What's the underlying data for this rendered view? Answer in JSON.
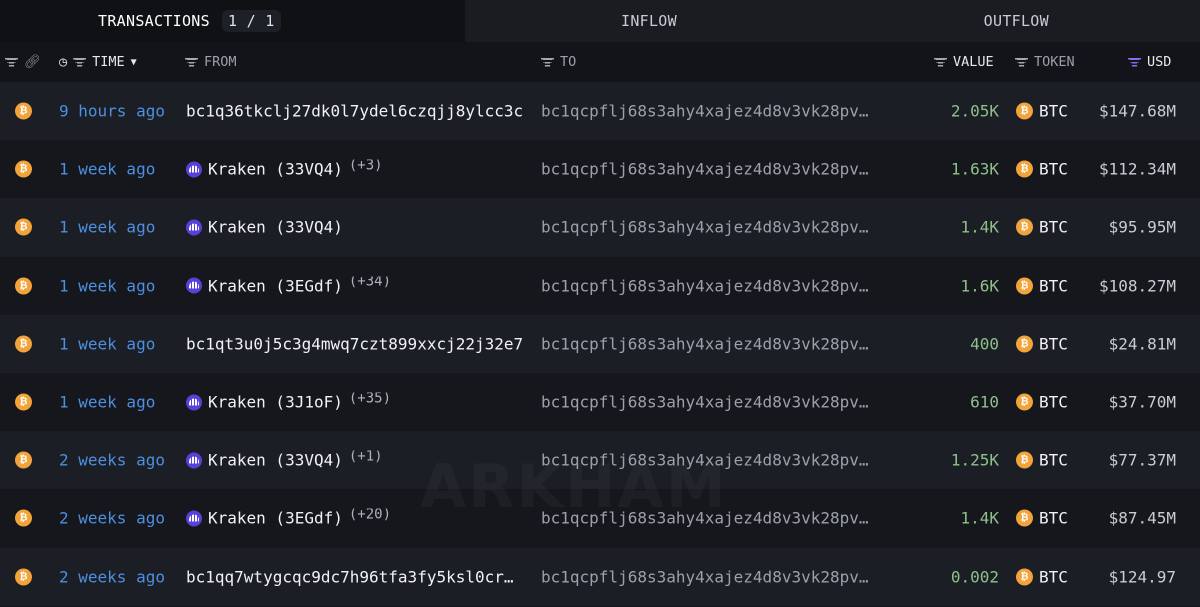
{
  "tabs": {
    "transactions": "TRANSACTIONS",
    "page": "1 / 1",
    "inflow": "INFLOW",
    "outflow": "OUTFLOW"
  },
  "columns": {
    "time": "TIME",
    "from": "FROM",
    "to": "TO",
    "value": "VALUE",
    "token": "TOKEN",
    "usd": "USD"
  },
  "colors": {
    "accent_time": "#4d8fe0",
    "value_green": "#8fc08a",
    "btc": "#f2a33a",
    "kraken": "#5841d8"
  },
  "watermark": "ARKHAM",
  "rows": [
    {
      "time": "9 hours ago",
      "from": "bc1q36tkclj27dk0l7ydel6czqjj8ylcc3c",
      "from_entity": false,
      "extra": "",
      "to": "bc1qcpflj68s3ahy4xajez4d8v3vk28pv…",
      "value": "2.05K",
      "token": "BTC",
      "usd": "$147.68M"
    },
    {
      "time": "1 week ago",
      "from": "Kraken (33VQ4)",
      "from_entity": true,
      "extra": "(+3)",
      "to": "bc1qcpflj68s3ahy4xajez4d8v3vk28pv…",
      "value": "1.63K",
      "token": "BTC",
      "usd": "$112.34M"
    },
    {
      "time": "1 week ago",
      "from": "Kraken (33VQ4)",
      "from_entity": true,
      "extra": "",
      "to": "bc1qcpflj68s3ahy4xajez4d8v3vk28pv…",
      "value": "1.4K",
      "token": "BTC",
      "usd": "$95.95M"
    },
    {
      "time": "1 week ago",
      "from": "Kraken (3EGdf)",
      "from_entity": true,
      "extra": "(+34)",
      "to": "bc1qcpflj68s3ahy4xajez4d8v3vk28pv…",
      "value": "1.6K",
      "token": "BTC",
      "usd": "$108.27M"
    },
    {
      "time": "1 week ago",
      "from": "bc1qt3u0j5c3g4mwq7czt899xxcj22j32e7",
      "from_entity": false,
      "extra": "",
      "to": "bc1qcpflj68s3ahy4xajez4d8v3vk28pv…",
      "value": "400",
      "token": "BTC",
      "usd": "$24.81M"
    },
    {
      "time": "1 week ago",
      "from": "Kraken (3J1oF)",
      "from_entity": true,
      "extra": "(+35)",
      "to": "bc1qcpflj68s3ahy4xajez4d8v3vk28pv…",
      "value": "610",
      "token": "BTC",
      "usd": "$37.70M"
    },
    {
      "time": "2 weeks ago",
      "from": "Kraken (33VQ4)",
      "from_entity": true,
      "extra": "(+1)",
      "to": "bc1qcpflj68s3ahy4xajez4d8v3vk28pv…",
      "value": "1.25K",
      "token": "BTC",
      "usd": "$77.37M"
    },
    {
      "time": "2 weeks ago",
      "from": "Kraken (3EGdf)",
      "from_entity": true,
      "extra": "(+20)",
      "to": "bc1qcpflj68s3ahy4xajez4d8v3vk28pv…",
      "value": "1.4K",
      "token": "BTC",
      "usd": "$87.45M"
    },
    {
      "time": "2 weeks ago",
      "from": "bc1qq7wtygcqc9dc7h96tfa3fy5ksl0cr…",
      "from_entity": false,
      "extra": "",
      "to": "bc1qcpflj68s3ahy4xajez4d8v3vk28pv…",
      "value": "0.002",
      "token": "BTC",
      "usd": "$124.97"
    }
  ]
}
